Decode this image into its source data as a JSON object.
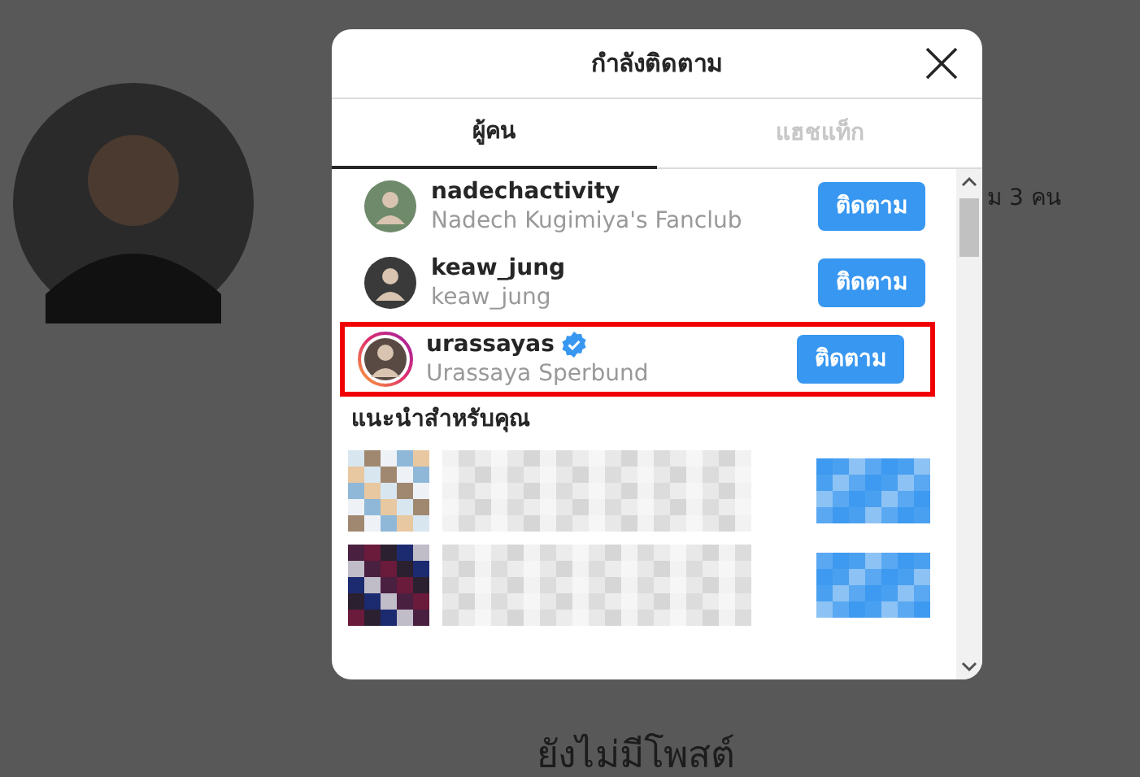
{
  "background": {
    "follower_text": "ม 3 คน",
    "empty_posts": "ยังไม่มีโพสต์"
  },
  "dialog": {
    "title": "กำลังติดตาม",
    "tabs": [
      {
        "label": "ผู้คน",
        "selected": true
      },
      {
        "label": "แฮชแท็ก",
        "selected": false
      }
    ],
    "accounts": [
      {
        "username": "nadechactivity",
        "full_name": "Nadech Kugimiya's Fanclub",
        "button": "ติดตาม",
        "verified": false,
        "story_ring": false,
        "highlighted": false
      },
      {
        "username": "keaw_jung",
        "full_name": "keaw_jung",
        "button": "ติดตาม",
        "verified": false,
        "story_ring": false,
        "highlighted": false
      },
      {
        "username": "urassayas",
        "full_name": "Urassaya Sperbund",
        "button": "ติดตาม",
        "verified": true,
        "story_ring": true,
        "highlighted": true
      }
    ],
    "suggestions": {
      "heading": "แนะนำสำหรับคุณ",
      "rows": [
        {
          "kind": "pixelated"
        },
        {
          "kind": "pixelated"
        }
      ]
    }
  }
}
